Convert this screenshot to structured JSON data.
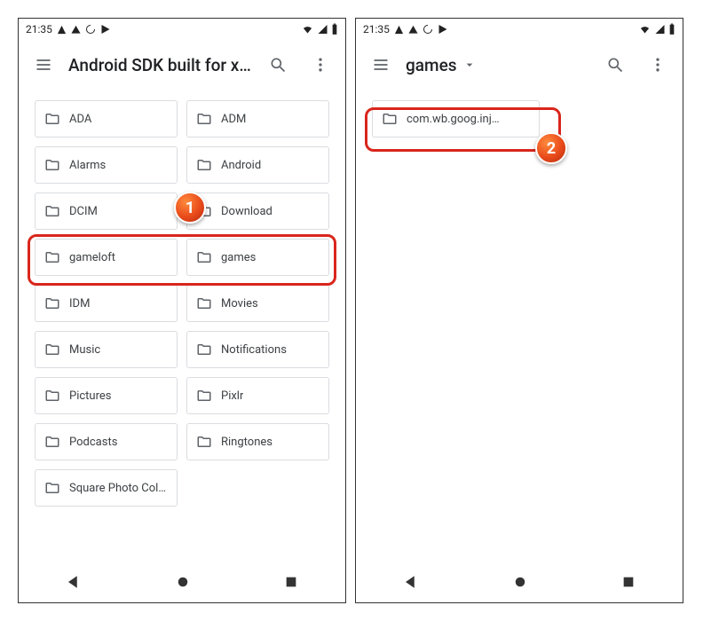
{
  "status": {
    "time": "21:35"
  },
  "screens": [
    {
      "title": "Android SDK built for x…",
      "has_dropdown": false,
      "layout": "grid",
      "folders": [
        "ADA",
        "ADM",
        "Alarms",
        "Android",
        "DCIM",
        "Download",
        "gameloft",
        "games",
        "IDM",
        "Movies",
        "Music",
        "Notifications",
        "Pictures",
        "Pixlr",
        "Podcasts",
        "Ringtones",
        "Square Photo Col…"
      ],
      "highlight": "hl1",
      "badge": {
        "num": "1",
        "cls": "badge1"
      }
    },
    {
      "title": "games",
      "has_dropdown": true,
      "layout": "list",
      "folders": [
        "com.wb.goog.inj…"
      ],
      "highlight": "hl2",
      "badge": {
        "num": "2",
        "cls": "badge2"
      }
    }
  ]
}
